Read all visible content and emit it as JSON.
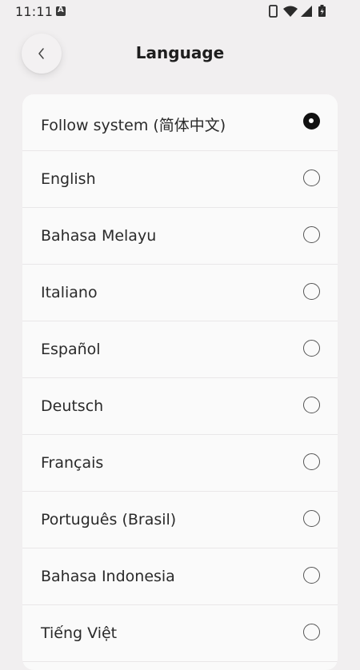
{
  "status_bar": {
    "time": "11:11",
    "icons": [
      "a-notification-icon",
      "phone-icon",
      "wifi-icon",
      "signal-icon",
      "battery-icon"
    ]
  },
  "header": {
    "title": "Language",
    "back_icon": "chevron-left-icon"
  },
  "languages": {
    "selected_index": 0,
    "items": [
      {
        "label": "Follow system (简体中文)",
        "selected": true
      },
      {
        "label": "English",
        "selected": false
      },
      {
        "label": "Bahasa Melayu",
        "selected": false
      },
      {
        "label": "Italiano",
        "selected": false
      },
      {
        "label": "Español",
        "selected": false
      },
      {
        "label": "Deutsch",
        "selected": false
      },
      {
        "label": "Français",
        "selected": false
      },
      {
        "label": "Português (Brasil)",
        "selected": false
      },
      {
        "label": "Bahasa Indonesia",
        "selected": false
      },
      {
        "label": "Tiếng Việt",
        "selected": false
      }
    ]
  },
  "colors": {
    "background": "#f1eff0",
    "card": "#fafafa",
    "divider": "#e9e7e8",
    "radio_selected": "#111111"
  }
}
